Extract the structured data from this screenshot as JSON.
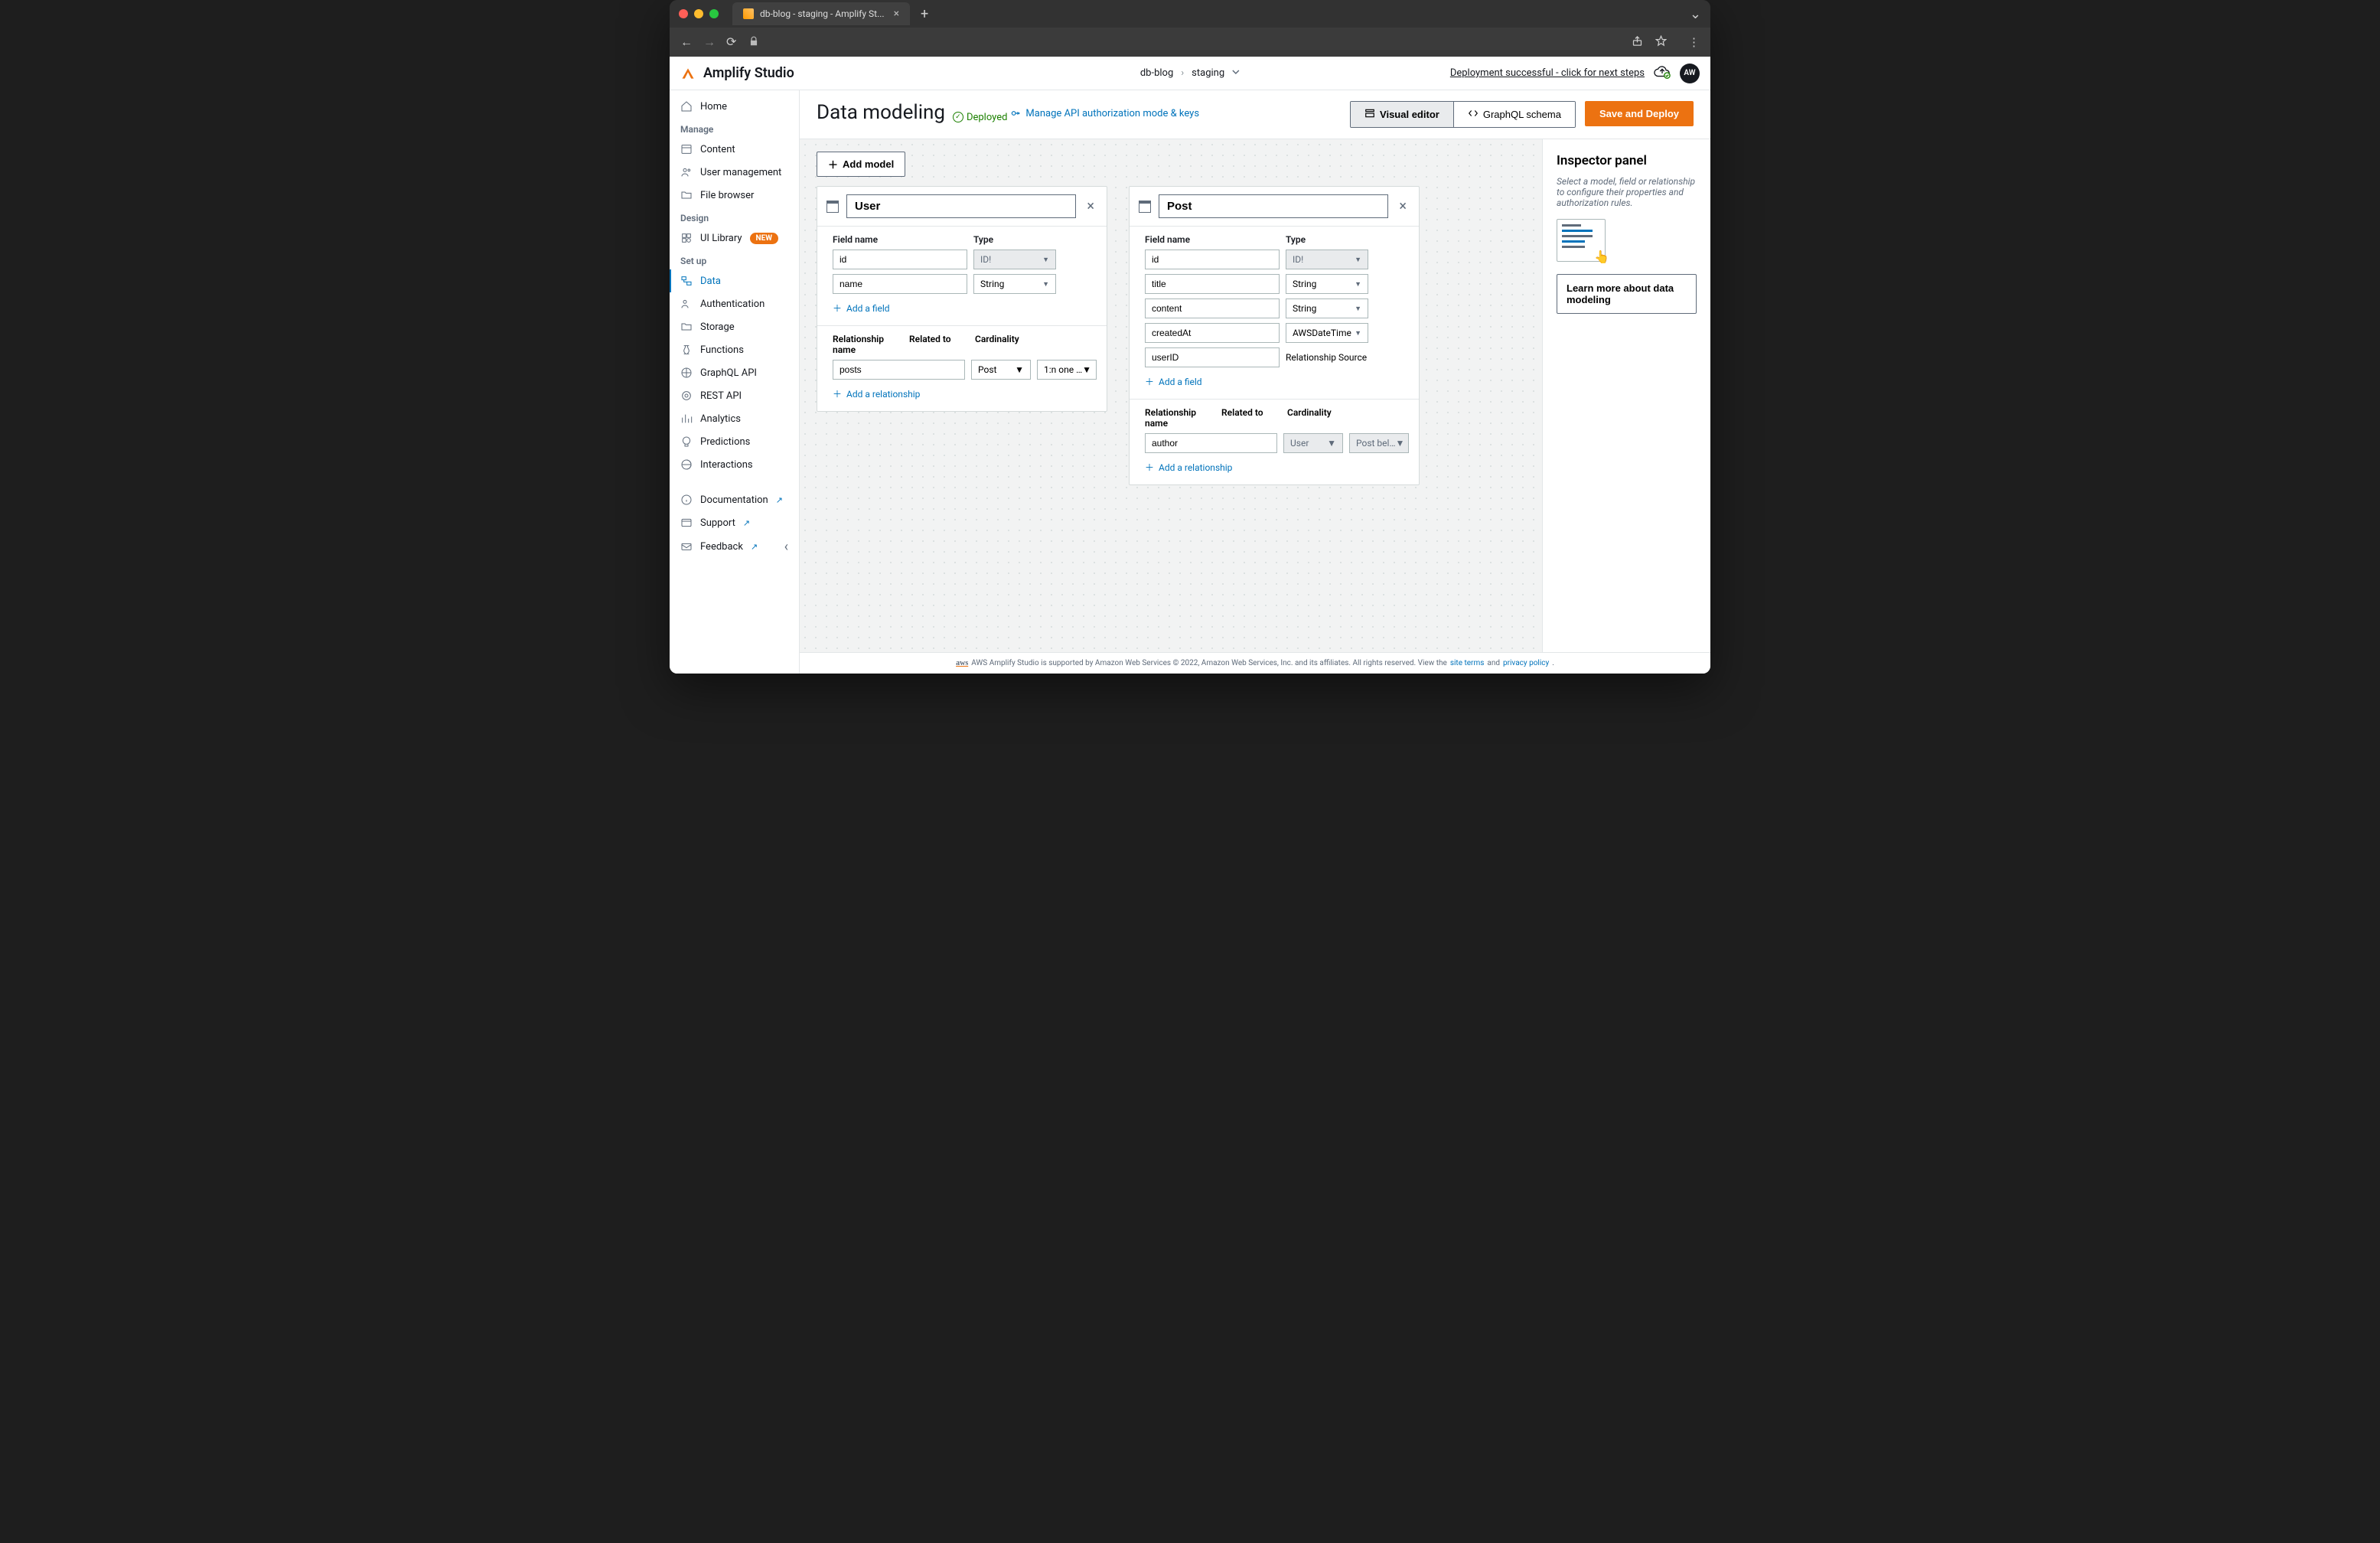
{
  "browser": {
    "tab_title": "db-blog - staging - Amplify St..."
  },
  "header": {
    "app_name": "Amplify Studio",
    "breadcrumb": {
      "project": "db-blog",
      "env": "staging"
    },
    "banner": "Deployment successful - click for next steps",
    "avatar_initials": "AW"
  },
  "sidebar": {
    "home": "Home",
    "sections": {
      "manage": "Manage",
      "design": "Design",
      "setup": "Set up"
    },
    "items": {
      "content": "Content",
      "user_mgmt": "User management",
      "file_browser": "File browser",
      "ui_library": "UI Library",
      "new_badge": "NEW",
      "data": "Data",
      "auth": "Authentication",
      "storage": "Storage",
      "functions": "Functions",
      "graphql": "GraphQL API",
      "rest": "REST API",
      "analytics": "Analytics",
      "predictions": "Predictions",
      "interactions": "Interactions",
      "docs": "Documentation",
      "support": "Support",
      "feedback": "Feedback"
    }
  },
  "page": {
    "title": "Data modeling",
    "status": "Deployed",
    "manage_link": "Manage API authorization mode & keys",
    "visual_editor": "Visual editor",
    "graphql_schema": "GraphQL schema",
    "save_deploy": "Save and Deploy",
    "add_model": "Add model"
  },
  "models": [
    {
      "name": "User",
      "field_header": "Field name",
      "type_header": "Type",
      "fields": [
        {
          "name": "id",
          "type": "ID!",
          "disabled": true
        },
        {
          "name": "name",
          "type": "String",
          "disabled": false
        }
      ],
      "add_field": "Add a field",
      "rel_headers": {
        "name": "Relationship name",
        "to": "Related to",
        "card": "Cardinality"
      },
      "relationships": [
        {
          "name": "posts",
          "to": "Post",
          "card": "1:n one …",
          "disabled": false
        }
      ],
      "add_rel": "Add a relationship"
    },
    {
      "name": "Post",
      "field_header": "Field name",
      "type_header": "Type",
      "fields": [
        {
          "name": "id",
          "type": "ID!",
          "disabled": true
        },
        {
          "name": "title",
          "type": "String",
          "disabled": false
        },
        {
          "name": "content",
          "type": "String",
          "disabled": false
        },
        {
          "name": "createdAt",
          "type": "AWSDateTime",
          "disabled": false
        },
        {
          "name": "userID",
          "type": "Relationship Source",
          "is_rel_source": true
        }
      ],
      "add_field": "Add a field",
      "rel_headers": {
        "name": "Relationship name",
        "to": "Related to",
        "card": "Cardinality"
      },
      "relationships": [
        {
          "name": "author",
          "to": "User",
          "card": "Post bel…",
          "disabled": true
        }
      ],
      "add_rel": "Add a relationship"
    }
  ],
  "inspector": {
    "title": "Inspector panel",
    "desc": "Select a model, field or relationship to configure their properties and authorization rules.",
    "learn": "Learn more about data modeling"
  },
  "footer": {
    "text_pre": "AWS Amplify Studio is supported by Amazon Web Services © 2022, Amazon Web Services, Inc. and its affiliates. All rights reserved. View the ",
    "site_terms": "site terms",
    "and": " and ",
    "privacy": "privacy policy",
    "period": " ."
  }
}
